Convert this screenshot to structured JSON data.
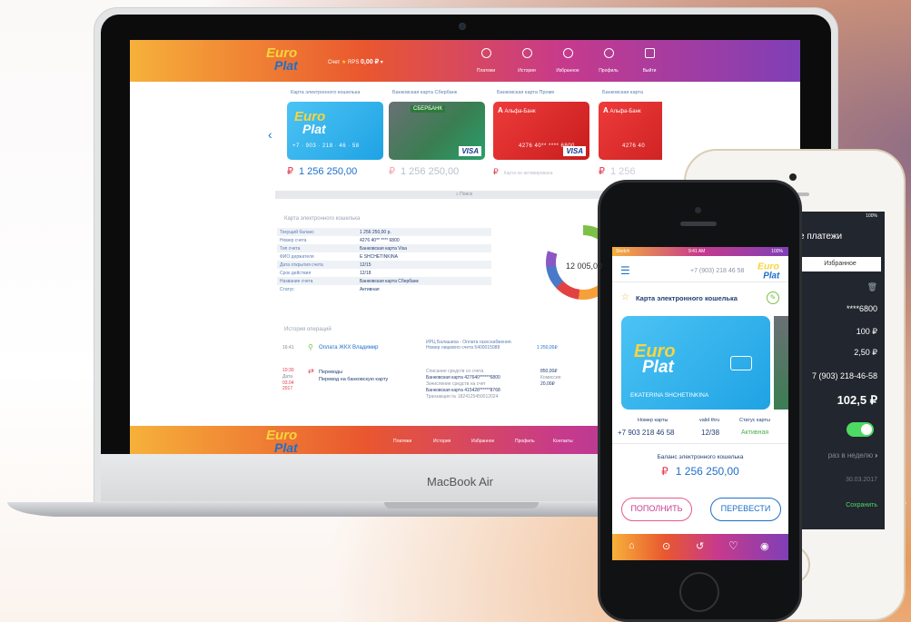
{
  "laptop": {
    "brand": "MacBook Air",
    "header": {
      "logo": {
        "part1": "Euro",
        "part2": "Plat"
      },
      "account_label": "Счет",
      "account_name": "RPS",
      "account_balance": "0,00 ₽",
      "nav": [
        {
          "label": "Платежи",
          "icon": "arrow-right-icon"
        },
        {
          "label": "История",
          "icon": "history-icon"
        },
        {
          "label": "Избранное",
          "icon": "heart-icon"
        },
        {
          "label": "Профиль",
          "icon": "user-icon"
        },
        {
          "label": "Выйти",
          "icon": "logout-icon"
        }
      ]
    },
    "cards": [
      {
        "title": "Карта электронного кошелька",
        "number": "+7 · 903 · 218 · 46 · 58",
        "balance": "1 256 250,00",
        "type": "euro"
      },
      {
        "title": "Банковская карта Сбербанк",
        "bank": "СБЕРБАНК",
        "number": "",
        "balance": "1 256 250,00",
        "type": "sber"
      },
      {
        "title": "Банковская карта Проме",
        "bank": "Альфа-Банк",
        "number": "4276 40** **** 6800",
        "balance": "Карта не активирована",
        "type": "alfa"
      },
      {
        "title": "Банковская карта",
        "bank": "Альфа-Банк",
        "number": "4276 40",
        "balance": "1 256",
        "type": "alfa"
      }
    ],
    "card_brand": "VISA",
    "currency_symbol": "₽",
    "search_placeholder": "Поиск",
    "details_title": "Карта электронного кошелька",
    "details": [
      {
        "label": "Текущий баланс",
        "value": "1 256 250,00 р."
      },
      {
        "label": "Номер счета",
        "value": "4276 40** **** 6800"
      },
      {
        "label": "Тип счета",
        "value": "Банковская карта Visa"
      },
      {
        "label": "ФИО держателя",
        "value": "E SHCHETINKINA"
      },
      {
        "label": "Дата открытия счета",
        "value": "12/15"
      },
      {
        "label": "Срок действия",
        "value": "12/18"
      },
      {
        "label": "Название счета",
        "value": "Банковская карта Сбербанк"
      },
      {
        "label": "Статус",
        "value": "Активная"
      }
    ],
    "donut_value": "12 005,00",
    "history_title": "История операций",
    "operations": [
      {
        "time": "16:41",
        "name": "Оплата ЖКХ Владимир",
        "desc": "ИРЦ Балашиха - Оплата газоснабжения. Номер лицевого счета 5400015088",
        "amount": "1 250,00₽"
      },
      {
        "time": "10:30",
        "date_label": "Дата",
        "date": "03.04 2017",
        "name": "Переводы",
        "sub": "Перевод на банковскую карту",
        "from_label": "Списание средств со счета",
        "from": "Банковская карта 427640******6800",
        "to_label": "Зачисление средств на счет",
        "to": "Банковская карта 415428******8768",
        "txn": "Транзакция № 1824125450012024",
        "amount1": "850,00₽",
        "amount2_label": "Комиссия",
        "amount2": "20,00₽"
      }
    ],
    "footer": {
      "logo": {
        "part1": "Euro",
        "part2": "Plat"
      },
      "links": [
        "Платежи",
        "История",
        "Избранное",
        "Профиль",
        "Контакты"
      ]
    }
  },
  "white_phone": {
    "status_battery": "100%",
    "title": "е платежи",
    "tab": "Избранное",
    "rows": [
      "****6800",
      "100 ₽",
      "2,50 ₽",
      "7 (903) 218-46-58",
      "102,5 ₽"
    ],
    "frequency": "раз в неделю",
    "date": "30.03.2017",
    "save_label": "Сохранить"
  },
  "black_phone": {
    "status_carrier": "Sketch",
    "status_time": "9:41 AM",
    "status_battery": "100%",
    "phone": "+7 (903) 218 46 58",
    "logo": {
      "part1": "Euro",
      "part2": "Plat"
    },
    "wallet_title": "Карта электронного кошелька",
    "card_holder": "EKATERINA SHCHETINKINA",
    "card_number_label": "Номер карты",
    "card_number": "+7 903 218 46 58",
    "valid_label": "valid thru",
    "valid": "12/38",
    "status_label": "Статус карты",
    "status": "Активная",
    "balance_label": "Баланс электронного кошелька",
    "balance": "1 256 250,00",
    "currency_symbol": "₽",
    "topup_label": "ПОПОЛНИТЬ",
    "transfer_label": "ПЕРЕВЕСТИ"
  },
  "colors": {
    "accent_blue": "#1e6fc9",
    "accent_red": "#e2384a",
    "brand_yellow": "#f6d53c",
    "gradient": [
      "#f6b13a",
      "#e9572f",
      "#c63a8d",
      "#7f3fb6"
    ]
  }
}
